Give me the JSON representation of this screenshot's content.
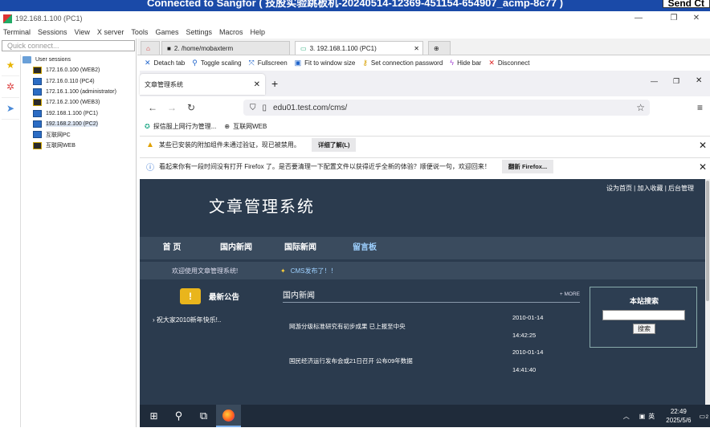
{
  "banner": {
    "text": "Connected to Sangfor ( 技股实验跳板机-20240514-12369-451154-654907_acmp-8c77 )",
    "button": "Send Ct"
  },
  "window": {
    "title": "192.168.1.100 (PC1)"
  },
  "menu": [
    "Terminal",
    "Sessions",
    "View",
    "X server",
    "Tools",
    "Games",
    "Settings",
    "Macros",
    "Help"
  ],
  "sidebar": {
    "quick_placeholder": "Quick connect...",
    "root": "User sessions",
    "sessions": [
      {
        "label": "172.16.0.100 (WEB2)",
        "icon": "key-icon"
      },
      {
        "label": "172.16.0.110 (PC4)",
        "icon": "monitor-icon"
      },
      {
        "label": "172.16.1.100 (administrator)",
        "icon": "monitor-icon"
      },
      {
        "label": "172.16.2.100 (WEB3)",
        "icon": "key-icon"
      },
      {
        "label": "192.168.1.100 (PC1)",
        "icon": "monitor-icon"
      },
      {
        "label": "192.168.2.100 (PC2)",
        "icon": "monitor-icon"
      },
      {
        "label": "互联网PC",
        "icon": "monitor-icon"
      },
      {
        "label": "互联网WEB",
        "icon": "key-icon"
      }
    ]
  },
  "tabs": [
    "2. /home/mobaxterm",
    "3. 192.168.1.100 (PC1)"
  ],
  "toolbar": [
    "Detach tab",
    "Toggle scaling",
    "Fullscreen",
    "Fit to window size",
    "Set connection password",
    "Hide bar",
    "Disconnect"
  ],
  "firefox": {
    "tab_title": "文章管理系统",
    "url": "edu01.test.com/cms/",
    "bookmarks": [
      "探信服上网行为管理...",
      "互联网WEB"
    ],
    "notice1": {
      "text": "某些已安装的附加组件未通过验证，现已被禁用。",
      "button": "详细了解(L)"
    },
    "notice2": {
      "text": "看起来你有一段时间没有打开 Firefox 了。是否要清理一下配置文件以获得近乎全新的体验？顺便说一句，欢迎回来！",
      "button": "翻新 Firefox..."
    }
  },
  "cms": {
    "top_links": "设为首页 | 加入收藏 | 后台管理",
    "logo": "文章管理系统",
    "nav": [
      "首 页",
      "国内新闻",
      "国际新闻",
      "留言板"
    ],
    "welcome": "欢迎使用文章管理系统!",
    "marquee": "CMS发布了！！",
    "notice_title": "最新公告",
    "notice_item": "祝大家2010新年快乐!..",
    "news_title": "国内新闻",
    "more": "+ MORE",
    "news": [
      {
        "title": "网游分级标准研究有初步成果 已上报至中央",
        "date": "2010-01-14",
        "time": "14:42:25"
      },
      {
        "title": "国民经济运行发布会或21日召开 公布09年数据",
        "date": "2010-01-14",
        "time": "14:41:40"
      }
    ],
    "search_title": "本站搜索",
    "search_button": "搜索"
  },
  "taskbar": {
    "lang": "英",
    "time": "22:49",
    "date": "2025/5/6",
    "badge": "2"
  }
}
